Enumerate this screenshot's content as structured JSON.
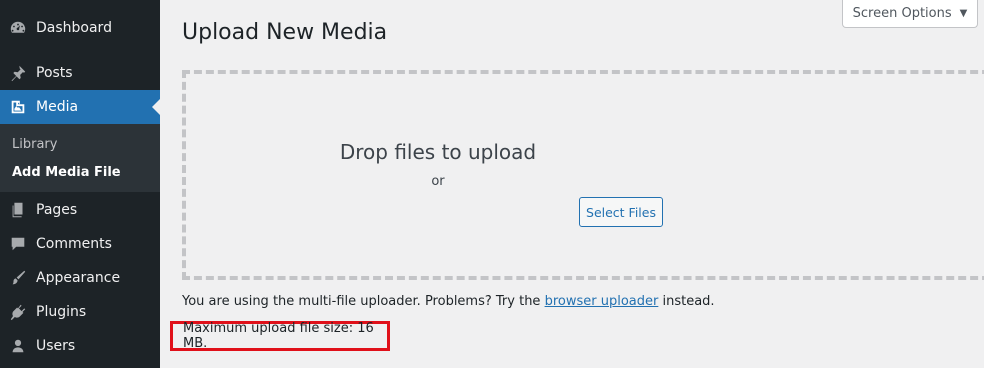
{
  "sidebar": {
    "items": [
      {
        "label": "Dashboard",
        "icon": "dashboard-icon"
      },
      {
        "label": "Posts",
        "icon": "pin-icon"
      },
      {
        "label": "Media",
        "icon": "media-icon"
      },
      {
        "label": "Pages",
        "icon": "pages-icon"
      },
      {
        "label": "Comments",
        "icon": "comment-icon"
      },
      {
        "label": "Appearance",
        "icon": "brush-icon"
      },
      {
        "label": "Plugins",
        "icon": "plugin-icon"
      },
      {
        "label": "Users",
        "icon": "user-icon"
      }
    ],
    "submenu": [
      {
        "label": "Library"
      },
      {
        "label": "Add Media File"
      }
    ]
  },
  "header": {
    "title": "Upload New Media",
    "screen_options": "Screen Options"
  },
  "uploader": {
    "drop_text": "Drop files to upload",
    "or_text": "or",
    "select_button": "Select Files",
    "note_prefix": "You are using the multi-file uploader. Problems? Try the ",
    "note_link": "browser uploader",
    "note_suffix": " instead.",
    "max_size": "Maximum upload file size: 16 MB."
  },
  "colors": {
    "sidebar_bg": "#1d2327",
    "accent": "#2271b1",
    "highlight_box": "#e0101a"
  }
}
